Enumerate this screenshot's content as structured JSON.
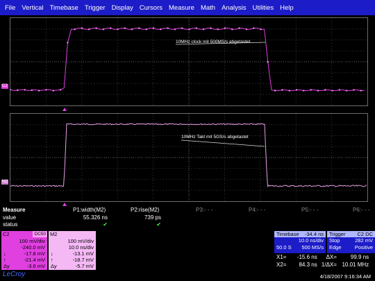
{
  "menu": [
    "File",
    "Vertical",
    "Timebase",
    "Trigger",
    "Display",
    "Cursors",
    "Measure",
    "Math",
    "Analysis",
    "Utilities",
    "Help"
  ],
  "colors": {
    "menu_bg": "#1c1cc8",
    "c2": "#e040e0",
    "m2": "#f4b8f4",
    "trace": "#e040e0",
    "check": "#40ff40"
  },
  "grid1": {
    "channel_label": "C2",
    "annotation": "10MHz clock mit 500MS/s abgetastet"
  },
  "grid2": {
    "channel_label": "M2",
    "annotation": "10MHz Takt mit 5GS/s abgetastet"
  },
  "measure": {
    "title": "Measure",
    "row_value": "value",
    "row_status": "status",
    "p1_label": "P1:width(M2)",
    "p1_value": "55.326 ns",
    "p2_label": "P2:rise(M2)",
    "p2_value": "739 ps",
    "p3_label": "P3:- - -",
    "p4_label": "P4:- - -",
    "p5_label": "P5:- - -",
    "p6_label": "P6:- - -",
    "check": "✔"
  },
  "c2box": {
    "title": "C2",
    "tag": "DC50",
    "vdiv": "100 mV/div",
    "offset": "-240.0 mV",
    "l1": "↓",
    "v1": "-17.8 mV",
    "l2": "↑",
    "v2": "-21.4 mV",
    "l3": "Δy",
    "v3": "-3.6 mV"
  },
  "m2box": {
    "title": "M2",
    "vdiv": "100 mV/div",
    "tdiv": "10.0 ns/div",
    "l1": "↓",
    "v1": "-13.1 mV",
    "l2": "↑",
    "v2": "-18.7 mV",
    "l3": "Δy",
    "v3": "-5.7 mV"
  },
  "timebase": {
    "title": "Timebase",
    "delay": "-34.4 ns",
    "tdiv": "10.0 ns/div",
    "samples": "50.0 S",
    "rate": "500 MS/s"
  },
  "trigger": {
    "title": "Trigger",
    "tag": "C2 DC",
    "mode": "Stop",
    "level": "282 mV",
    "type": "Edge",
    "slope": "Positive"
  },
  "cursors": {
    "x1_label": "X1=",
    "x1": "-15.6 ns",
    "dx_label": "ΔX=",
    "dx": "99.9 ns",
    "x2_label": "X2=",
    "x2": "84.3 ns",
    "inv_label": "1/ΔX=",
    "inv": "10.01 MHz"
  },
  "logo": "LeCroy",
  "datetime": "4/18/2007 9:16:34 AM"
}
